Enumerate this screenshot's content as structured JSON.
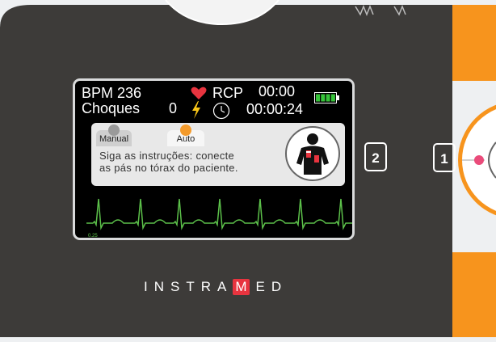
{
  "screen": {
    "bpm_label": "BPM 236",
    "rcp_label": "RCP",
    "rcp_time": "00:00",
    "shocks_label": "Choques",
    "shocks_count": "0",
    "elapsed_time": "00:00:24",
    "battery_level": 1.0,
    "tabs": {
      "manual": "Manual",
      "auto": "Auto",
      "selected": "auto"
    },
    "instruction_line1": "Siga as instruções: conecte",
    "instruction_line2": "as pás no tórax do paciente.",
    "ecg_scale_value": "0.25",
    "ecg_scale_unit": "mV"
  },
  "buttons": {
    "shock_button_2": "2",
    "power_button_1": "1"
  },
  "brand": {
    "before": "INSTRA",
    "highlight": "M",
    "after": "ED"
  },
  "colors": {
    "housing": "#3d3b39",
    "orange": "#f7941d",
    "ecg_trace": "#5cc04a",
    "heart": "#e8343f",
    "battery": "#37c43a",
    "auto_dot": "#f39a2b"
  }
}
